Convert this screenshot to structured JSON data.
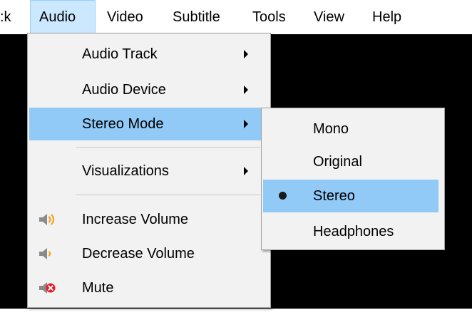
{
  "menubar": {
    "items": [
      {
        "label": ":k"
      },
      {
        "label": "Audio"
      },
      {
        "label": "Video"
      },
      {
        "label": "Subtitle"
      },
      {
        "label": "Tools"
      },
      {
        "label": "View"
      },
      {
        "label": "Help"
      }
    ]
  },
  "audio_menu": {
    "items": [
      {
        "label": "Audio Track"
      },
      {
        "label": "Audio Device"
      },
      {
        "label": "Stereo Mode"
      },
      {
        "label": "Visualizations"
      },
      {
        "label": "Increase Volume",
        "icon": "volume-up-icon"
      },
      {
        "label": "Decrease Volume",
        "icon": "volume-down-icon"
      },
      {
        "label": "Mute",
        "icon": "mute-icon"
      }
    ]
  },
  "stereo_submenu": {
    "items": [
      {
        "label": "Mono"
      },
      {
        "label": "Original"
      },
      {
        "label": "Stereo",
        "selected": true
      },
      {
        "label": "Headphones"
      }
    ]
  },
  "colors": {
    "highlight": "#91c9f7",
    "menu_bg": "#f2f2f2",
    "speaker_icon": "#8a8a8a",
    "volume_waves": "#f7a21b",
    "mute_badge": "#e51c23"
  }
}
